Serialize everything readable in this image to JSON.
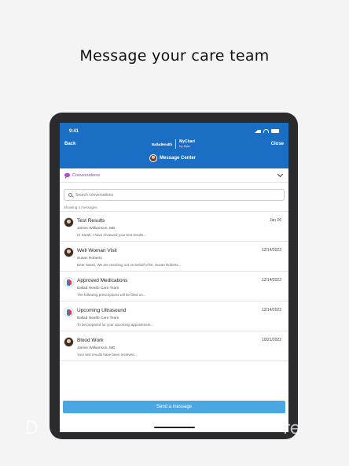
{
  "headline": "Message your care team",
  "status": {
    "time": "9:41"
  },
  "nav": {
    "back": "Back",
    "close": "Close",
    "brand": "BalladHealth",
    "mychart": "MyChart",
    "mychart_sub": "by Epic",
    "title": "Message Center"
  },
  "conversations": {
    "label": "Conversations"
  },
  "search": {
    "placeholder": "Search conversations"
  },
  "showing": "Showing 4 messages",
  "messages": [
    {
      "subject": "Test Results",
      "date": "Jan 26",
      "sender": "Jaimie Williamson, MD",
      "preview": "Hi Sarah, I have reviewed your test results...",
      "avatar": "person"
    },
    {
      "subject": "Well Woman Visit",
      "date": "12/14/2022",
      "sender": "Susan Roberts",
      "preview": "Dear Sarah, We are reaching out on behalf of Dr. Susan Roberts...",
      "avatar": "person"
    },
    {
      "subject": "Approved Medications",
      "date": "12/14/2022",
      "sender": "Ballad Health Care Team",
      "preview": "The following prescriptions will be filled on...",
      "avatar": "team"
    },
    {
      "subject": "Upcoming Ultrasound",
      "date": "12/14/2022",
      "sender": "Ballad Health Care Team",
      "preview": "To be prepared for your upcoming appointment...",
      "avatar": "team"
    },
    {
      "subject": "Blood Work",
      "date": "10/21/2022",
      "sender": "Jaimie Williamson, MD",
      "preview": "Your test results have been recieved...",
      "avatar": "person"
    }
  ],
  "send_button": "Send a message",
  "background_text_left": "D",
  "background_text_right": "re"
}
